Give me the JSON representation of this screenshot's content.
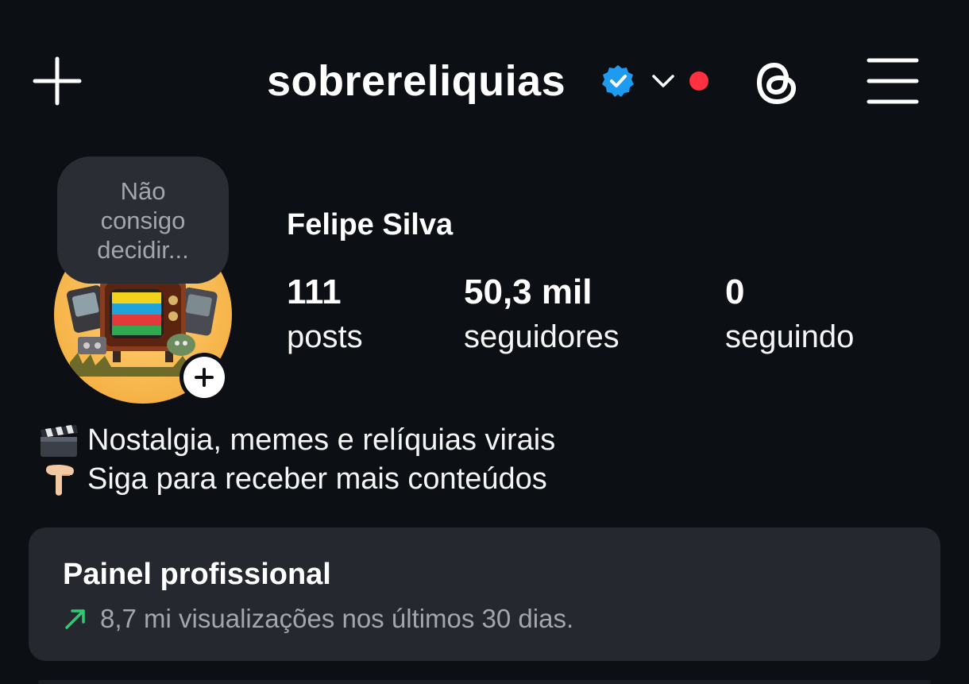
{
  "header": {
    "username": "sobrereliquias",
    "verified": true,
    "notification_dot_color": "#ff3040",
    "icons": [
      "plus-icon",
      "verified-badge-icon",
      "chevron-down-icon",
      "threads-icon",
      "hamburger-menu-icon"
    ]
  },
  "profile": {
    "full_name": "Felipe Silva",
    "note": "Não consigo decidir...",
    "stats": [
      {
        "value": "111",
        "label": "posts"
      },
      {
        "value": "50,3 mil",
        "label": "seguidores"
      },
      {
        "value": "0",
        "label": "seguindo"
      }
    ]
  },
  "bio": {
    "lines": [
      {
        "emoji": "clapper-board-icon",
        "text": "Nostalgia, memes e relíquias virais"
      },
      {
        "emoji": "pointing-down-hand-icon",
        "text": "Siga para receber mais conteúdos"
      }
    ]
  },
  "dashboard": {
    "title": "Painel profissional",
    "subtitle": "8,7 mi visualizações nos últimos 30 dias.",
    "trend_color": "#2ecc71"
  },
  "colors": {
    "background": "#0c0f14",
    "card": "#25282f",
    "verified_blue": "#1d9bf0"
  }
}
